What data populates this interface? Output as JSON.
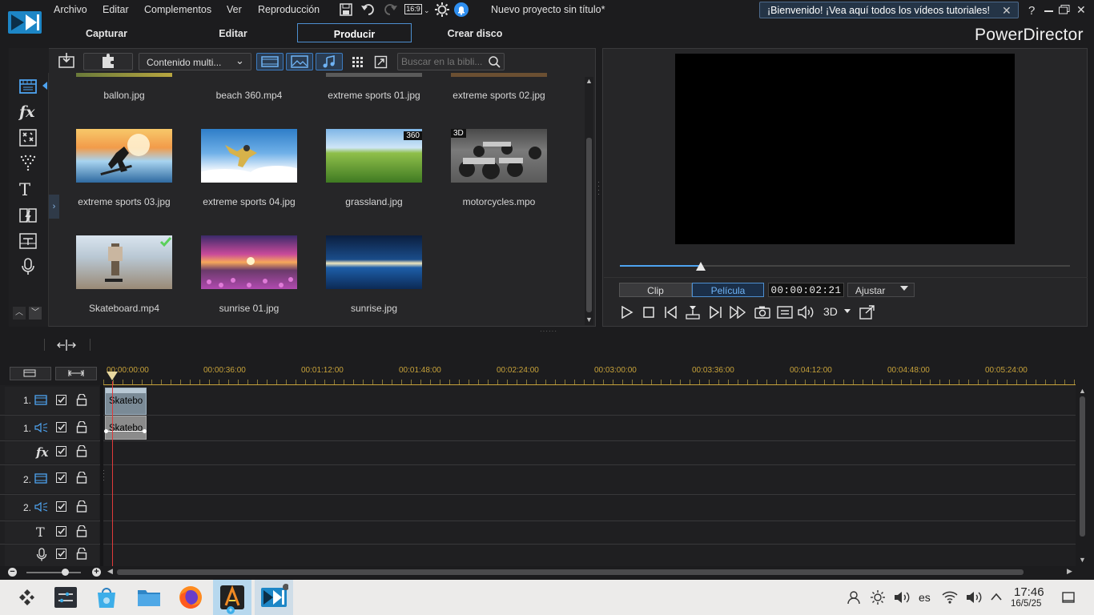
{
  "menu": {
    "items": [
      "Archivo",
      "Editar",
      "Complementos",
      "Ver",
      "Reproducción"
    ],
    "aspect": "16:9",
    "project_title": "Nuevo proyecto sin título*",
    "welcome": "¡Bienvenido! ¡Vea aquí todos los vídeos tutoriales!",
    "help": "?"
  },
  "tabs": [
    "Capturar",
    "Editar",
    "Producir",
    "Crear disco"
  ],
  "active_tab": "Producir",
  "brand": "PowerDirector",
  "library": {
    "filter": "Contenido multi...",
    "search_placeholder": "Buscar en la bibli...",
    "items": [
      {
        "name": "ballon.jpg",
        "badge": ""
      },
      {
        "name": "beach 360.mp4",
        "badge": ""
      },
      {
        "name": "extreme sports 01.jpg",
        "badge": ""
      },
      {
        "name": "extreme sports 02.jpg",
        "badge": ""
      },
      {
        "name": "extreme sports 03.jpg",
        "badge": ""
      },
      {
        "name": "extreme sports 04.jpg",
        "badge": ""
      },
      {
        "name": "grassland.jpg",
        "badge": "360"
      },
      {
        "name": "motorcycles.mpo",
        "badge": "3D"
      },
      {
        "name": "Skateboard.mp4",
        "badge": "check"
      },
      {
        "name": "sunrise 01.jpg",
        "badge": ""
      },
      {
        "name": "sunrise.jpg",
        "badge": ""
      }
    ]
  },
  "preview": {
    "clip_label": "Clip",
    "movie_label": "Película",
    "timecode": "00:00:02:21",
    "fit_label": "Ajustar",
    "mode_3d": "3D",
    "progress": 0.18
  },
  "timeline": {
    "ticks": [
      "00:00:00:00",
      "00:00:36:00",
      "00:01:12:00",
      "00:01:48:00",
      "00:02:24:00",
      "00:03:00:00",
      "00:03:36:00",
      "00:04:12:00",
      "00:04:48:00",
      "00:05:24:00"
    ],
    "tracks": [
      {
        "num": "1.",
        "type": "video"
      },
      {
        "num": "1.",
        "type": "audio"
      },
      {
        "num": "",
        "type": "fx"
      },
      {
        "num": "2.",
        "type": "video"
      },
      {
        "num": "2.",
        "type": "audio"
      },
      {
        "num": "",
        "type": "text"
      },
      {
        "num": "",
        "type": "voice"
      }
    ],
    "clip_video_label": "Skatebo",
    "clip_audio_label": "Skatebo"
  },
  "taskbar": {
    "lang": "es",
    "time": "17:46",
    "date": "16/5/25"
  }
}
